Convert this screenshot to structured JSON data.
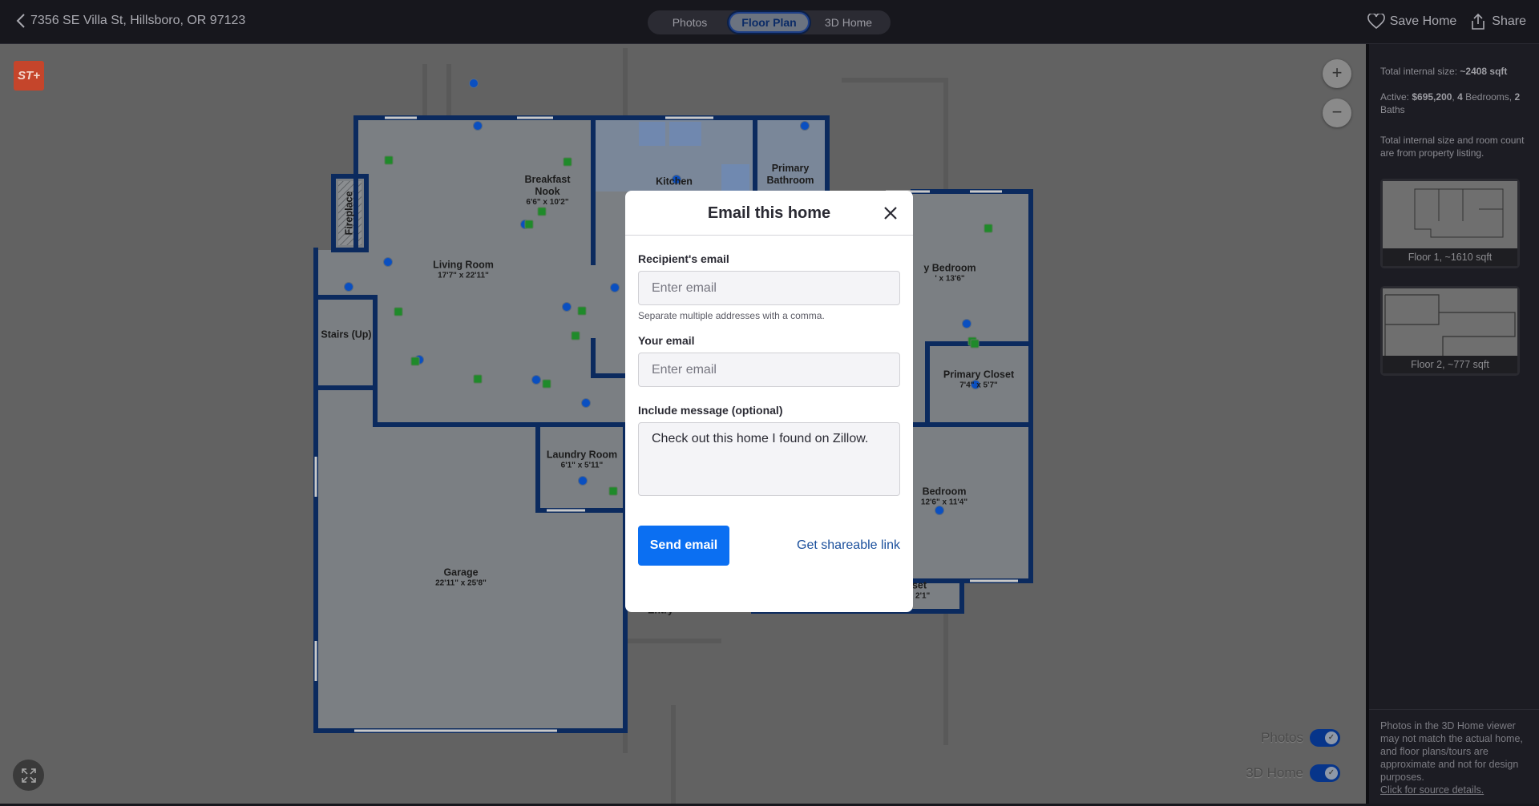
{
  "header": {
    "address": "7356 SE Villa St, Hillsboro, OR 97123",
    "tabs": [
      {
        "label": "Photos",
        "active": false
      },
      {
        "label": "Floor Plan",
        "active": true
      },
      {
        "label": "3D Home",
        "active": false
      }
    ],
    "save_label": "Save Home",
    "share_label": "Share"
  },
  "map": {
    "logo_text": "ST+",
    "rooms": [
      {
        "name": "Living Room",
        "dims": "17'7\" x 22'11\""
      },
      {
        "name": "Breakfast Nook",
        "dims": "6'6\" x 10'2\""
      },
      {
        "name": "Kitchen",
        "dims": ""
      },
      {
        "name": "Primary Bathroom",
        "dims": ""
      },
      {
        "name": "Fireplace",
        "dims": ""
      },
      {
        "name": "Stairs (Up)",
        "dims": ""
      },
      {
        "name": "Laundry Room",
        "dims": "6'1\" x 5'11\""
      },
      {
        "name": "Garage",
        "dims": "22'11\" x 25'8\""
      },
      {
        "name": "y Bedroom",
        "dims": "' x 13'6\""
      },
      {
        "name": "Primary Closet",
        "dims": "7'4\" x 5'7\""
      },
      {
        "name": "Bedroom",
        "dims": "12'6\" x 11'4\""
      },
      {
        "name": "set",
        "dims": "x 2'1\""
      },
      {
        "name": "Entry",
        "dims": ""
      }
    ],
    "zoom_in": "+",
    "zoom_out": "−",
    "toggles": [
      {
        "label": "Photos",
        "on": true
      },
      {
        "label": "3D Home",
        "on": true
      }
    ],
    "colors": {
      "wall": "#0b2a5e",
      "photo_marker": "#0a4fc0",
      "pano_marker": "#1f8a2a",
      "accent": "#0b6ff2"
    }
  },
  "panel": {
    "size_label": "Total internal size: ",
    "size_value": "~2408 sqft",
    "status_label": "Active: ",
    "price": "$695,200",
    "sep1": ", ",
    "beds": "4",
    "beds_label": " Bedrooms, ",
    "baths": "2",
    "baths_label": " Baths",
    "source_note": "Total internal size and room count are from property listing.",
    "floors": [
      {
        "label": "Floor 1, ~1610 sqft"
      },
      {
        "label": "Floor 2, ~777 sqft"
      }
    ],
    "disclaimer": "Photos in the 3D Home viewer may not match the actual home, and floor plans/tours are approximate and not for design purposes.",
    "source_link": "Click for source details."
  },
  "modal": {
    "title": "Email this home",
    "recipient_label": "Recipient's email",
    "recipient_placeholder": "Enter email",
    "recipient_hint": "Separate multiple addresses with a comma.",
    "your_label": "Your email",
    "your_placeholder": "Enter email",
    "message_label": "Include message (optional)",
    "message_value": "Check out this home I found on Zillow.",
    "send_label": "Send email",
    "link_label": "Get shareable link"
  }
}
